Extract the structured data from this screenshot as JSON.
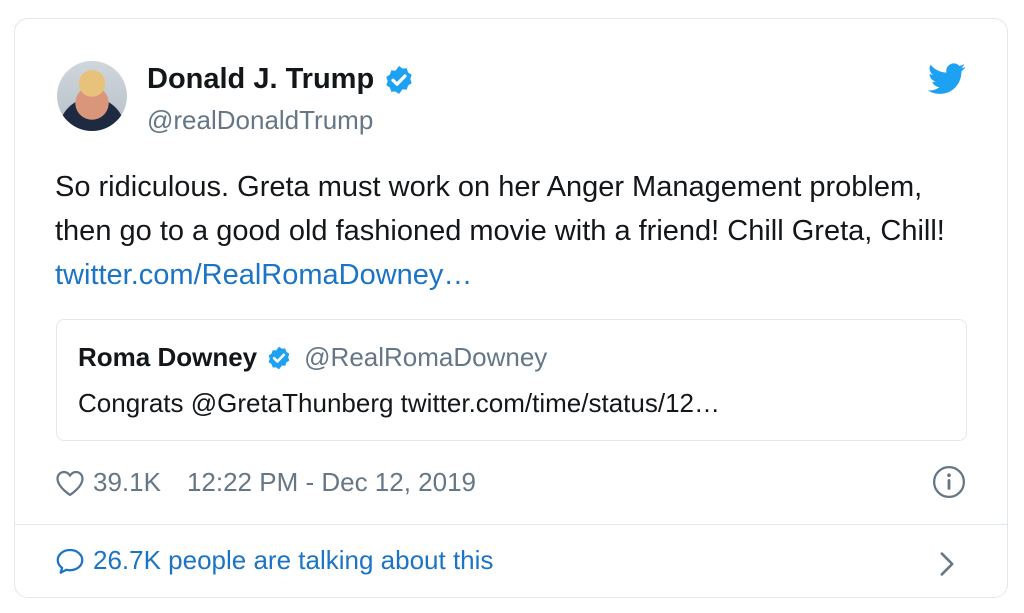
{
  "author": {
    "name": "Donald J. Trump",
    "handle": "@realDonaldTrump"
  },
  "tweet": {
    "text": "So ridiculous. Greta must work on her Anger Management problem, then go to a good old fashioned movie with a friend! Chill Greta, Chill! ",
    "link": "twitter.com/RealRomaDowney…"
  },
  "quote": {
    "name": "Roma Downey",
    "handle": "@RealRomaDowney",
    "text": "Congrats @GretaThunberg twitter.com/time/status/12…"
  },
  "meta": {
    "likes": "39.1K",
    "timestamp": "12:22 PM - Dec 12, 2019"
  },
  "footer": {
    "talking": "26.7K people are talking about this"
  },
  "colors": {
    "link": "#1b74c5",
    "verified": "#1da1f2",
    "secondary": "#657786",
    "border": "#e1e8ed"
  },
  "icons": [
    "verified-badge-icon",
    "twitter-bird-icon",
    "heart-icon",
    "info-icon",
    "speech-bubble-icon",
    "chevron-right-icon"
  ]
}
